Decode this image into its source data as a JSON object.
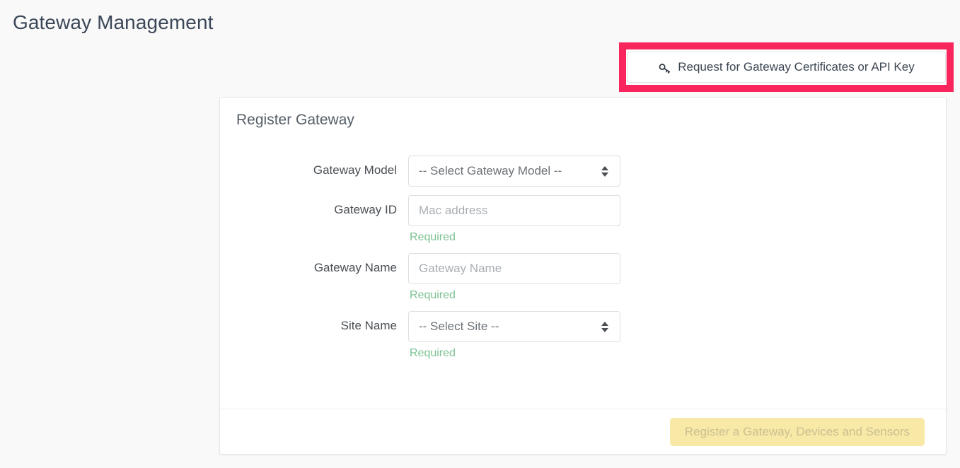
{
  "page": {
    "title": "Gateway Management",
    "background_color": "#f9f9fa"
  },
  "highlight": {
    "color": "#f9265e"
  },
  "cert_action": {
    "label": "Request for Gateway Certificates or API Key",
    "icon": "key-icon"
  },
  "card": {
    "title": "Register Gateway",
    "fields": [
      {
        "label": "Gateway Model",
        "type": "select",
        "value": "-- Select Gateway Model --",
        "required_note": ""
      },
      {
        "label": "Gateway ID",
        "type": "text",
        "value": "",
        "placeholder": "Mac address",
        "required_note": "Required"
      },
      {
        "label": "Gateway Name",
        "type": "text",
        "value": "",
        "placeholder": "Gateway Name",
        "required_note": "Required"
      },
      {
        "label": "Site Name",
        "type": "select",
        "value": "-- Select Site --",
        "required_note": "Required"
      }
    ],
    "footer": {
      "submit_label": "Register a Gateway, Devices and Sensors",
      "submit_bg_color": "#f8e9a6",
      "submit_text_color": "#cbbf91",
      "submit_disabled": true
    }
  },
  "colors": {
    "required_green": "#7dc292",
    "title_text": "#3c4858"
  }
}
